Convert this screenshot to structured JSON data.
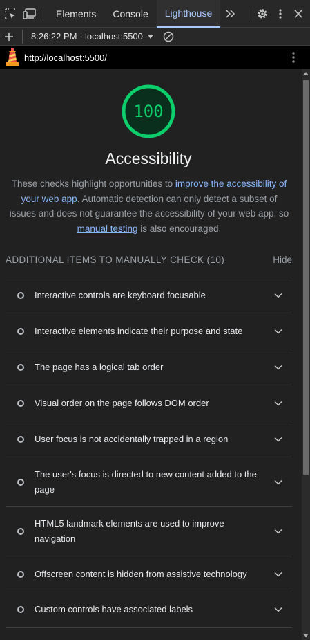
{
  "tabbar": {
    "tabs": [
      {
        "label": "Elements"
      },
      {
        "label": "Console"
      },
      {
        "label": "Lighthouse"
      }
    ],
    "more_label": ">>"
  },
  "toolbar": {
    "report_label": "8:26:22 PM - localhost:5500"
  },
  "header": {
    "url": "http://localhost:5500/"
  },
  "category": {
    "score": "100",
    "score_color": "#0cce6b",
    "title": "Accessibility",
    "desc_part1": "These checks highlight opportunities to ",
    "desc_link1": "improve the accessibility of your web app",
    "desc_part2": ". Automatic detection can only detect a subset of issues and does not guarantee the accessibility of your web app, so ",
    "desc_link2": "manual testing",
    "desc_part3": " is also encouraged."
  },
  "group": {
    "title": "ADDITIONAL ITEMS TO MANUALLY CHECK (10)",
    "hide_label": "Hide"
  },
  "audits": [
    {
      "label": "Interactive controls are keyboard focusable"
    },
    {
      "label": "Interactive elements indicate their purpose and state"
    },
    {
      "label": "The page has a logical tab order"
    },
    {
      "label": "Visual order on the page follows DOM order"
    },
    {
      "label": "User focus is not accidentally trapped in a region"
    },
    {
      "label": "The user's focus is directed to new content added to the page"
    },
    {
      "label": "HTML5 landmark elements are used to improve navigation"
    },
    {
      "label": "Offscreen content is hidden from assistive technology"
    },
    {
      "label": "Custom controls have associated labels"
    }
  ]
}
